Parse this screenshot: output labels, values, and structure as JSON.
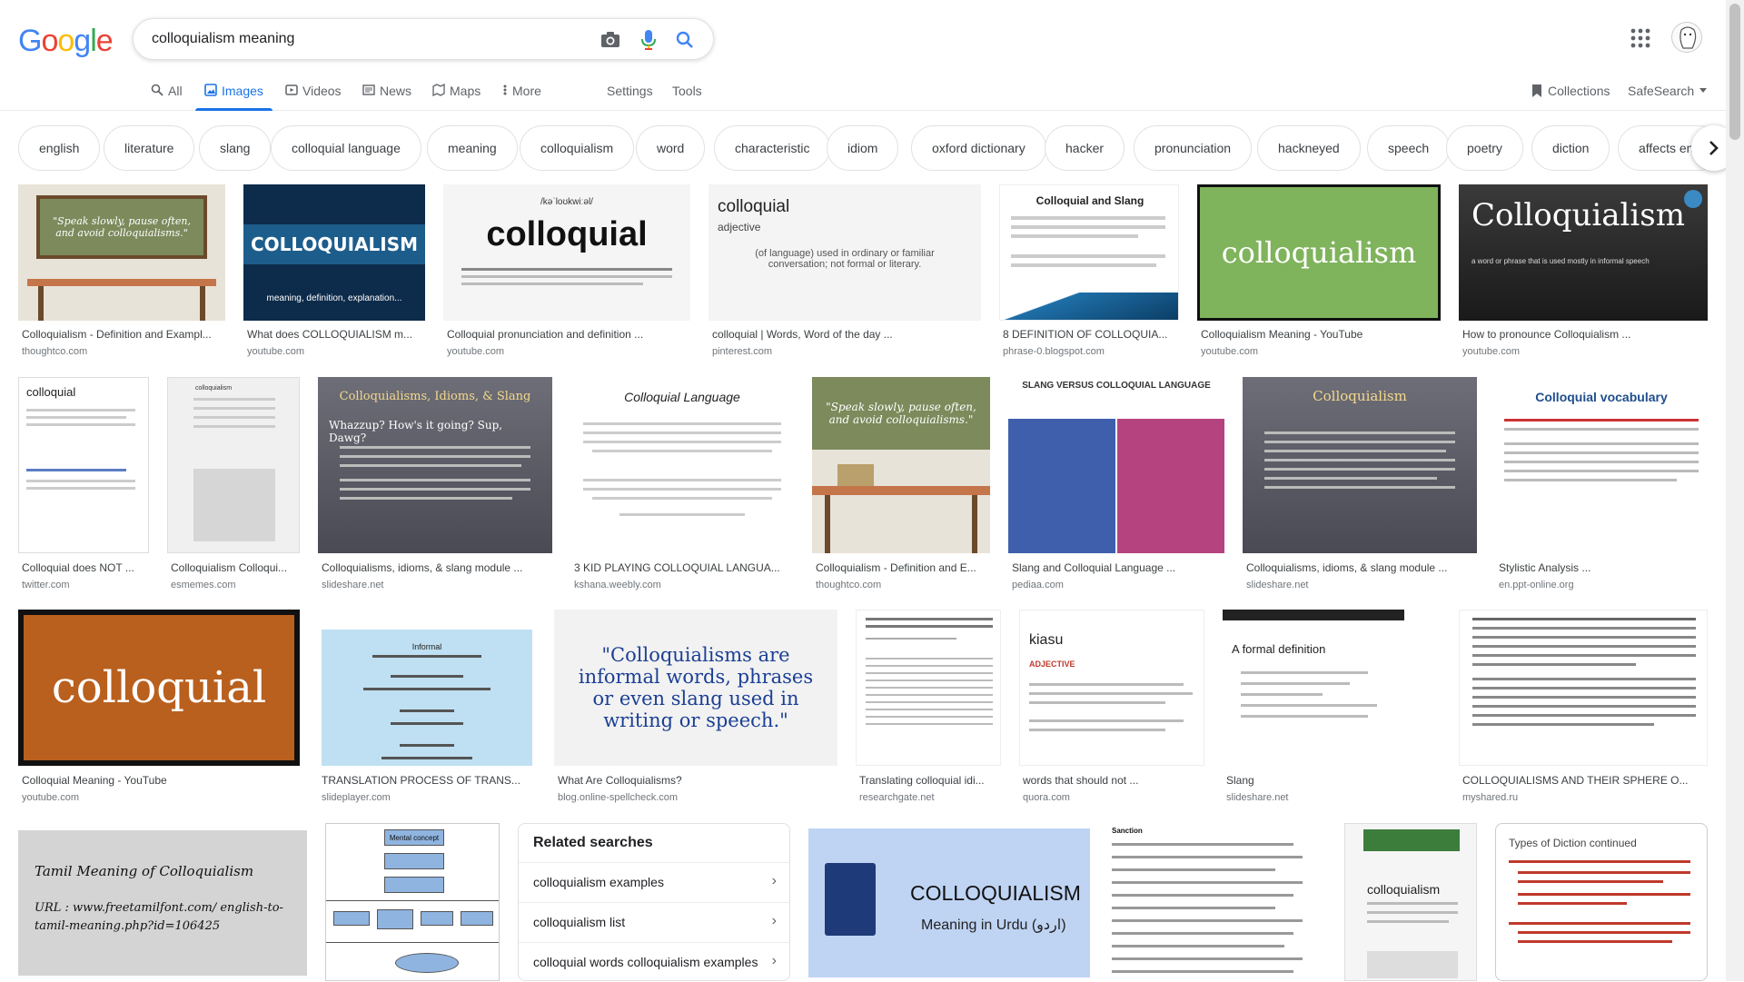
{
  "logo": "Google",
  "search": {
    "query": "colloquialism meaning"
  },
  "tabs": [
    {
      "label": "All"
    },
    {
      "label": "Images"
    },
    {
      "label": "Videos"
    },
    {
      "label": "News"
    },
    {
      "label": "Maps"
    },
    {
      "label": "More"
    }
  ],
  "tools": {
    "settings": "Settings",
    "tools": "Tools"
  },
  "right_tabs": {
    "collections": "Collections",
    "safesearch": "SafeSearch"
  },
  "chips": [
    "english",
    "literature",
    "slang",
    "colloquial language",
    "meaning",
    "colloquialism",
    "word",
    "characteristic",
    "idiom",
    "oxford dictionary",
    "hacker",
    "pronunciation",
    "hackneyed",
    "speech",
    "poetry",
    "diction",
    "affects eng"
  ],
  "results": [
    {
      "title": "Colloquialism - Definition and Exampl...",
      "source": "thoughtco.com",
      "thumb_text": "\"Speak slowly, pause often, and avoid colloquialisms.\""
    },
    {
      "title": "What does COLLOQUIALISM m...",
      "source": "youtube.com",
      "thumb_text": "COLLOQUIALISM",
      "thumb_sub": "meaning, definition, explanation..."
    },
    {
      "title": "Colloquial pronunciation and definition ...",
      "source": "youtube.com",
      "thumb_text": "colloquial",
      "thumb_sub": "/kəˈloʊkwiːəl/"
    },
    {
      "title": "colloquial | Words, Word of the day ...",
      "source": "pinterest.com",
      "thumb_text": "colloquial",
      "thumb_sub": "adjective",
      "thumb_desc": "(of language) used in ordinary or familiar conversation; not formal or literary."
    },
    {
      "title": "8 DEFINITION OF COLLOQUIA...",
      "source": "phrase-0.blogspot.com",
      "thumb_text": "Colloquial and Slang"
    },
    {
      "title": "Colloquialism Meaning - YouTube",
      "source": "youtube.com",
      "thumb_text": "colloquialism"
    },
    {
      "title": "How to pronounce Colloquialism ...",
      "source": "youtube.com",
      "thumb_text": "Colloquialism",
      "thumb_sub": "a word or phrase that is used mostly in informal speech"
    },
    {
      "title": "Colloquial does NOT ...",
      "source": "twitter.com",
      "thumb_text": "colloquial"
    },
    {
      "title": "Colloquialism Colloqui...",
      "source": "esmemes.com",
      "thumb_text": "colloquialism"
    },
    {
      "title": "Colloquialisms, idioms, & slang module ...",
      "source": "slideshare.net",
      "thumb_text": "Colloquialisms, Idioms, & Slang",
      "thumb_sub": "Whazzup? How's it going? Sup, Dawg?"
    },
    {
      "title": "3 KID PLAYING COLLOQUIAL LANGUA...",
      "source": "kshana.weebly.com",
      "thumb_text": "Colloquial Language"
    },
    {
      "title": "Colloquialism - Definition and E...",
      "source": "thoughtco.com",
      "thumb_text": "\"Speak slowly, pause often, and avoid colloquialisms.\""
    },
    {
      "title": "Slang and Colloquial Language ...",
      "source": "pediaa.com",
      "thumb_text": "SLANG VERSUS COLLOQUIAL LANGUAGE"
    },
    {
      "title": "Colloquialisms, idioms, & slang module ...",
      "source": "slideshare.net",
      "thumb_text": "Colloquialism"
    },
    {
      "title": "Stylistic Analysis ...",
      "source": "en.ppt-online.org",
      "thumb_text": "Colloquial vocabulary"
    },
    {
      "title": "Colloquial Meaning - YouTube",
      "source": "youtube.com",
      "thumb_text": "colloquial"
    },
    {
      "title": "TRANSLATION PROCESS OF TRANS...",
      "source": "slideplayer.com",
      "thumb_text": "Informal"
    },
    {
      "title": "What Are Colloquialisms?",
      "source": "blog.online-spellcheck.com",
      "thumb_text": "\"Colloquialisms are informal words, phrases or even slang used in writing or speech.\""
    },
    {
      "title": "Translating colloquial idi...",
      "source": "researchgate.net",
      "thumb_text": ""
    },
    {
      "title": "words that should not ...",
      "source": "quora.com",
      "thumb_text": "kiasu",
      "thumb_sub": "ADJECTIVE"
    },
    {
      "title": "Slang",
      "source": "slideshare.net",
      "thumb_text": "A formal definition"
    },
    {
      "title": "COLLOQUIALISMS AND THEIR SPHERE O...",
      "source": "myshared.ru",
      "thumb_text": ""
    },
    {
      "thumb_text": "Tamil Meaning of Colloquialism",
      "thumb_sub": "URL : www.freetamilfont.com/ english-to-tamil-meaning.php?id=106425"
    },
    {
      "thumb_text": "Mental concept"
    },
    {
      "thumb_text": "COLLOQUIALISM",
      "thumb_sub": "Meaning in Urdu (اردو)"
    },
    {
      "thumb_text": "Sanction"
    },
    {
      "thumb_text": "colloquialism"
    },
    {
      "thumb_text": "Types of Diction continued"
    }
  ],
  "related": {
    "title": "Related searches",
    "items": [
      "colloquialism examples",
      "colloquialism list",
      "colloquial words colloquialism examples"
    ]
  },
  "colors": {
    "accent": "#1a73e8",
    "chip_border": "#dfe1e5",
    "link_gray": "#70757a"
  }
}
